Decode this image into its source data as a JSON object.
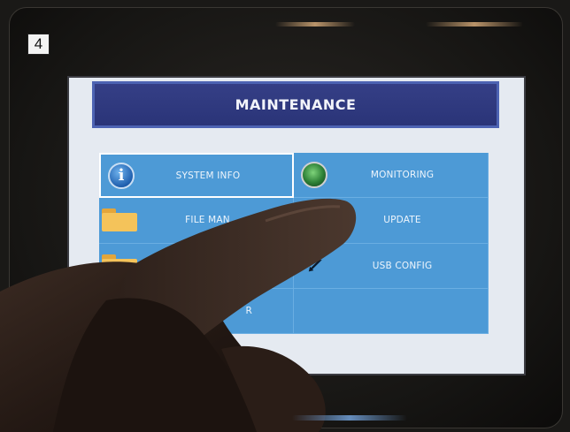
{
  "step_badge": "4",
  "screen": {
    "title": "MAINTENANCE",
    "menu": [
      {
        "label": "SYSTEM INFO",
        "icon": "info-icon",
        "selected": true
      },
      {
        "label": "MONITORING",
        "icon": "monitoring-icon"
      },
      {
        "label": "FILE MAN",
        "icon": "folder-icon"
      },
      {
        "label": "UPDATE",
        "icon": "update-icon"
      },
      {
        "label": "",
        "icon": "folder-icon"
      },
      {
        "label": "USB CONFIG",
        "icon": "usb-icon"
      },
      {
        "label": "R",
        "icon": ""
      },
      {
        "label": "",
        "icon": ""
      }
    ]
  },
  "colors": {
    "title_bar": "#2a3478",
    "menu_bg": "#4d9ad6",
    "screen_bg": "#e5eaf1",
    "bezel": "#161513"
  }
}
